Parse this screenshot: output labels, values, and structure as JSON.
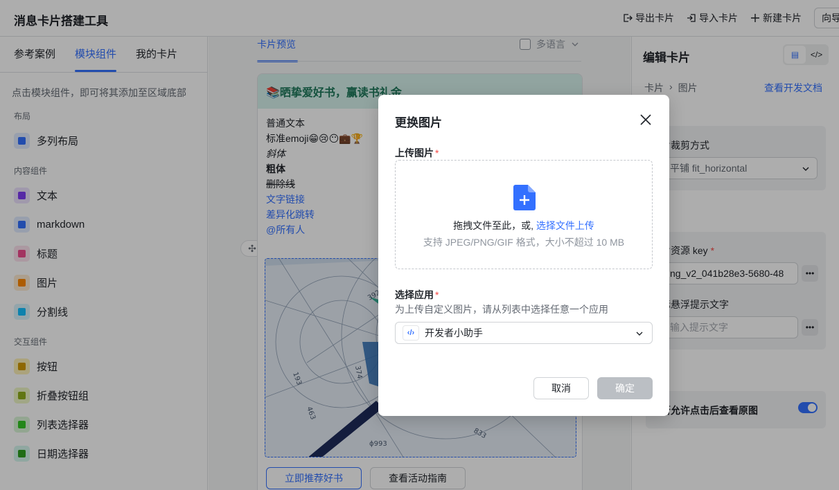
{
  "header": {
    "title": "消息卡片搭建工具",
    "export_label": "导出卡片",
    "import_label": "导入卡片",
    "new_label": "新建卡片",
    "cut_button_label": "向导"
  },
  "left": {
    "tabs": [
      "参考案例",
      "模块组件",
      "我的卡片"
    ],
    "active_tab": "模块组件",
    "hint": "点击模块组件，即可将其添加至区域底部",
    "sections": [
      {
        "title": "布局",
        "items": [
          {
            "label": "多列布局",
            "icon": "columns-icon",
            "color": "#3370ff",
            "bg": "#e1eaff"
          }
        ]
      },
      {
        "title": "内容组件",
        "items": [
          {
            "label": "文本",
            "icon": "text-icon",
            "color": "#7f3bf5",
            "bg": "#ece2fe"
          },
          {
            "label": "markdown",
            "icon": "markdown-icon",
            "color": "#3370ff",
            "bg": "#e1eaff"
          },
          {
            "label": "标题",
            "icon": "title-icon",
            "color": "#f14b8e",
            "bg": "#fde2ee"
          },
          {
            "label": "图片",
            "icon": "image-icon",
            "color": "#ff8800",
            "bg": "#feead2"
          },
          {
            "label": "分割线",
            "icon": "divider-icon",
            "color": "#14c0ff",
            "bg": "#d9f3fd"
          }
        ]
      },
      {
        "title": "交互组件",
        "items": [
          {
            "label": "按钮",
            "icon": "button-icon",
            "color": "#d19a00",
            "bg": "#fdf0b7"
          },
          {
            "label": "折叠按钮组",
            "icon": "more-buttons-icon",
            "color": "#8fae1b",
            "bg": "#eef6c6"
          },
          {
            "label": "列表选择器",
            "icon": "list-select-icon",
            "color": "#34c724",
            "bg": "#d9f5d6"
          },
          {
            "label": "日期选择器",
            "icon": "date-picker-icon",
            "color": "#2ea121",
            "bg": "#d5f6ee"
          }
        ]
      }
    ]
  },
  "center": {
    "preview_tab": "卡片预览",
    "multilang_label": "多语言",
    "card": {
      "header_title": "📚晒挚爱好书，赢读书礼金",
      "lines": [
        {
          "text": "普通文本",
          "style": "normal"
        },
        {
          "text": "标准emoji😁😢😶💼🏆",
          "style": "normal"
        },
        {
          "text": "斜体",
          "style": "italic"
        },
        {
          "text": "粗体",
          "style": "bold"
        },
        {
          "text": "删除线",
          "style": "strike"
        },
        {
          "text": "文字链接",
          "style": "link"
        },
        {
          "text": "差异化跳转",
          "style": "link"
        },
        {
          "text": "@所有人",
          "style": "link"
        }
      ],
      "buttons": [
        "立即推荐好书",
        "查看活动指南"
      ]
    }
  },
  "right": {
    "title": "编辑卡片",
    "breadcrumb": [
      "卡片",
      "图片"
    ],
    "doc_link": "查看开发文档",
    "crop_label": "片裁剪方式",
    "crop_value": "平铺 fit_horizontal",
    "key_label": "片资源 key",
    "key_value": "ng_v2_041b28e3-5680-48",
    "hover_label": "标悬浮提示文字",
    "hover_placeholder": "输入提示文字",
    "preview_label": "否允许点击后查看原图",
    "preview_enabled": true
  },
  "modal": {
    "title": "更换图片",
    "upload_label": "上传图片",
    "dz_text": "拖拽文件至此，或, ",
    "dz_link": "选择文件上传",
    "dz_sub": "支持 JPEG/PNG/GIF 格式，大小不超过 10 MB",
    "app_label": "选择应用",
    "app_desc": "为上传自定义图片，请从列表中选择任意一个应用",
    "app_selected": "开发者小助手",
    "cancel_label": "取消",
    "confirm_label": "确定"
  },
  "colors": {
    "accent": "#3370ff",
    "danger": "#f54a45"
  }
}
